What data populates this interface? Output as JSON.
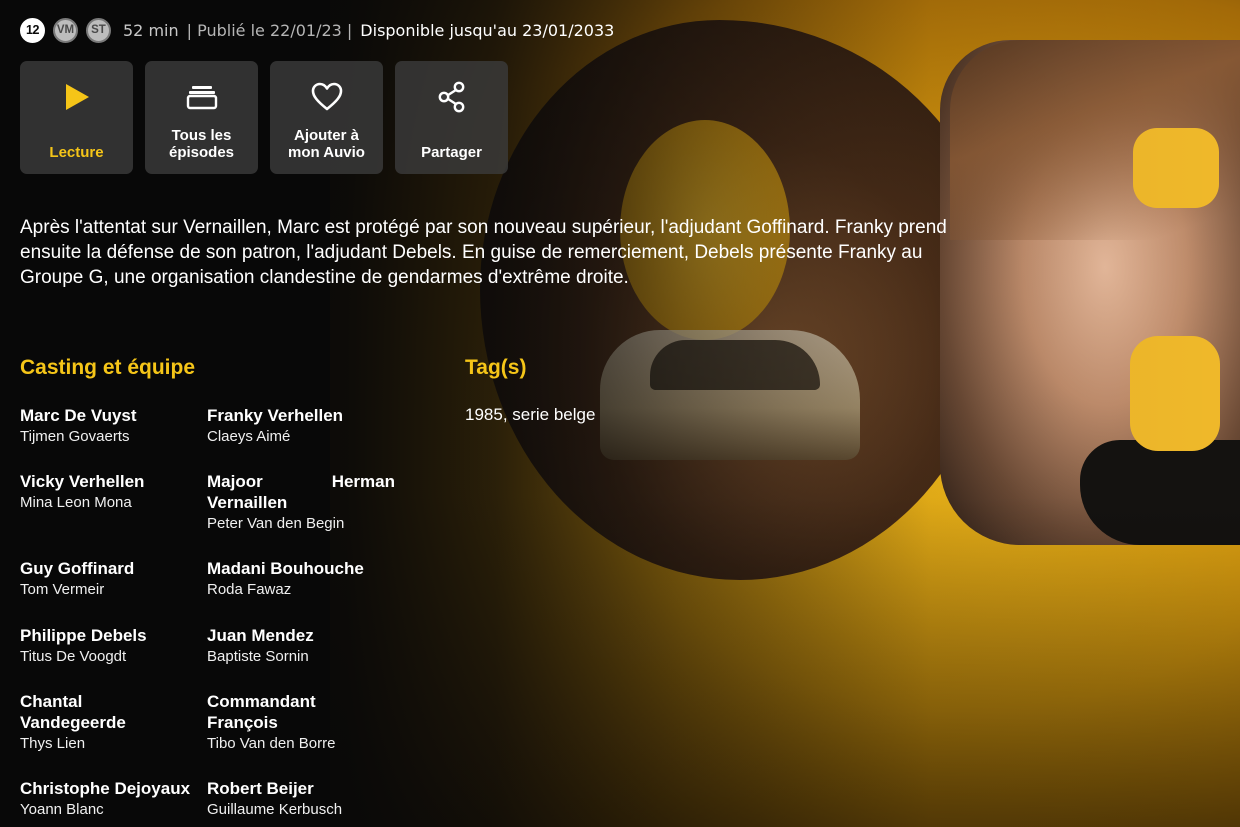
{
  "meta": {
    "age_rating": "12",
    "badge_vm": "VM",
    "badge_st": "ST",
    "duration": "52 min",
    "published": "| Publié le 22/01/23 |",
    "available": "Disponible jusqu'au 23/01/2033"
  },
  "actions": [
    {
      "label": "Lecture",
      "icon": "play-icon"
    },
    {
      "label": "Tous les épisodes",
      "icon": "episodes-stack-icon"
    },
    {
      "label": "Ajouter à mon Auvio",
      "icon": "heart-icon"
    },
    {
      "label": "Partager",
      "icon": "share-icon"
    }
  ],
  "synopsis": "Après l'attentat sur Vernaillen, Marc est protégé par son nouveau supérieur, l'adjudant Goffinard. Franky prend ensuite la défense de son patron, l'adjudant Debels. En guise de remerciement, Debels présente Franky au Groupe G, une organisation clandestine de gendarmes d'extrême droite.",
  "cast": {
    "title": "Casting et équipe",
    "entries": [
      {
        "role": "Marc De Vuyst",
        "actor": "Tijmen Govaerts"
      },
      {
        "role": "Franky Verhellen",
        "actor": "Claeys Aimé"
      },
      {
        "role": "Vicky Verhellen",
        "actor": "Mina Leon Mona"
      },
      {
        "role": "Majoor Herman Vernaillen",
        "role_line1_a": "Majoor",
        "role_line1_b": "Herman",
        "role_line2": "Vernaillen",
        "actor": "Peter Van den Begin"
      },
      {
        "role": "Guy Goffinard",
        "actor": "Tom Vermeir"
      },
      {
        "role": "Madani Bouhouche",
        "actor": "Roda Fawaz"
      },
      {
        "role": "Philippe Debels",
        "actor": "Titus De Voogdt"
      },
      {
        "role": "Juan Mendez",
        "actor": "Baptiste Sornin"
      },
      {
        "role": "Chantal Vandegeerde",
        "role_line1": "Chantal",
        "role_line2": "Vandegeerde",
        "actor": "Thys Lien"
      },
      {
        "role": "Commandant François",
        "role_line1": "Commandant",
        "role_line2": "François",
        "actor": "Tibo Van den Borre"
      },
      {
        "role": "Christophe Dejoyaux",
        "actor": "Yoann Blanc"
      },
      {
        "role": "Robert Beijer",
        "actor": "Guillaume Kerbusch"
      }
    ]
  },
  "tags": {
    "title": "Tag(s)",
    "value": "1985, serie belge"
  },
  "colors": {
    "accent": "#f5c518",
    "background": "#0a0a0a",
    "button_bg": "#3a3a3a"
  }
}
